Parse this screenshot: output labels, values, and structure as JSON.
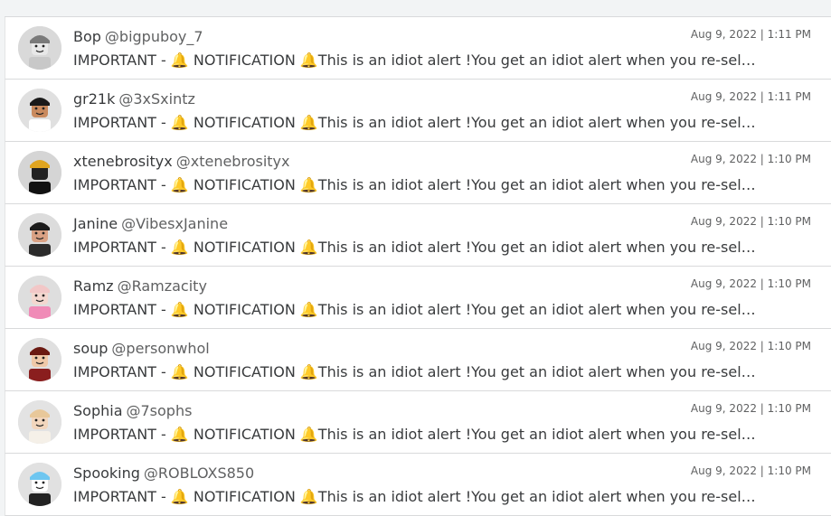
{
  "messages": [
    {
      "name": "Bop",
      "handle": "@bigpuboy_7",
      "time": "Aug 9, 2022 | 1:11 PM",
      "text": "IMPORTANT  -  🔔 NOTIFICATION 🔔This is an idiot alert !You get an idiot alert when you re-sel…",
      "avatar_bg": "#d9d9d9",
      "avatar_hair": "#7a7a7a",
      "avatar_skin": "#e8e8e8",
      "avatar_shirt": "#c8c8c8"
    },
    {
      "name": "gr21k",
      "handle": "@3xSxintz",
      "time": "Aug 9, 2022 | 1:11 PM",
      "text": "IMPORTANT  -  🔔 NOTIFICATION 🔔This is an idiot alert !You get an idiot alert when you re-sel…",
      "avatar_bg": "#e0e0e0",
      "avatar_hair": "#1a1a1a",
      "avatar_skin": "#c98a5e",
      "avatar_shirt": "#ffffff"
    },
    {
      "name": "xtenebrosityx",
      "handle": "@xtenebrosityx",
      "time": "Aug 9, 2022 | 1:10 PM",
      "text": "IMPORTANT  -  🔔 NOTIFICATION 🔔This is an idiot alert !You get an idiot alert when you re-sel…",
      "avatar_bg": "#d5d5d5",
      "avatar_hair": "#e0a520",
      "avatar_skin": "#222222",
      "avatar_shirt": "#111111"
    },
    {
      "name": "Janine",
      "handle": "@VibesxJanine",
      "time": "Aug 9, 2022 | 1:10 PM",
      "text": "IMPORTANT  -  🔔 NOTIFICATION 🔔This is an idiot alert !You get an idiot alert when you re-sel…",
      "avatar_bg": "#dcdcdc",
      "avatar_hair": "#1b1b1b",
      "avatar_skin": "#d9a184",
      "avatar_shirt": "#2b2b2b"
    },
    {
      "name": "Ramz",
      "handle": "@Ramzacity",
      "time": "Aug 9, 2022 | 1:10 PM",
      "text": "IMPORTANT  -  🔔 NOTIFICATION 🔔This is an idiot alert !You get an idiot alert when you re-sel…",
      "avatar_bg": "#dedede",
      "avatar_hair": "#f2c7c7",
      "avatar_skin": "#f4d7cf",
      "avatar_shirt": "#f08bb7"
    },
    {
      "name": "soup",
      "handle": "@personwhol",
      "time": "Aug 9, 2022 | 1:10 PM",
      "text": "IMPORTANT  -  🔔 NOTIFICATION 🔔This is an idiot alert !You get an idiot alert when you re-sel…",
      "avatar_bg": "#e0e0e0",
      "avatar_hair": "#6b1a12",
      "avatar_skin": "#f0c9a8",
      "avatar_shirt": "#8a1e1e"
    },
    {
      "name": "Sophia",
      "handle": "@7sophs",
      "time": "Aug 9, 2022 | 1:10 PM",
      "text": "IMPORTANT  -  🔔 NOTIFICATION 🔔This is an idiot alert !You get an idiot alert when you re-sel…",
      "avatar_bg": "#e3e3e3",
      "avatar_hair": "#e8c89a",
      "avatar_skin": "#f2d6bd",
      "avatar_shirt": "#f5f0e8"
    },
    {
      "name": "Spooking",
      "handle": "@ROBLOXS850",
      "time": "Aug 9, 2022 | 1:10 PM",
      "text": "IMPORTANT  -  🔔 NOTIFICATION 🔔This is an idiot alert !You get an idiot alert when you re-sel…",
      "avatar_bg": "#e1e1e1",
      "avatar_hair": "#6ec6f0",
      "avatar_skin": "#ffffff",
      "avatar_shirt": "#222222"
    }
  ]
}
